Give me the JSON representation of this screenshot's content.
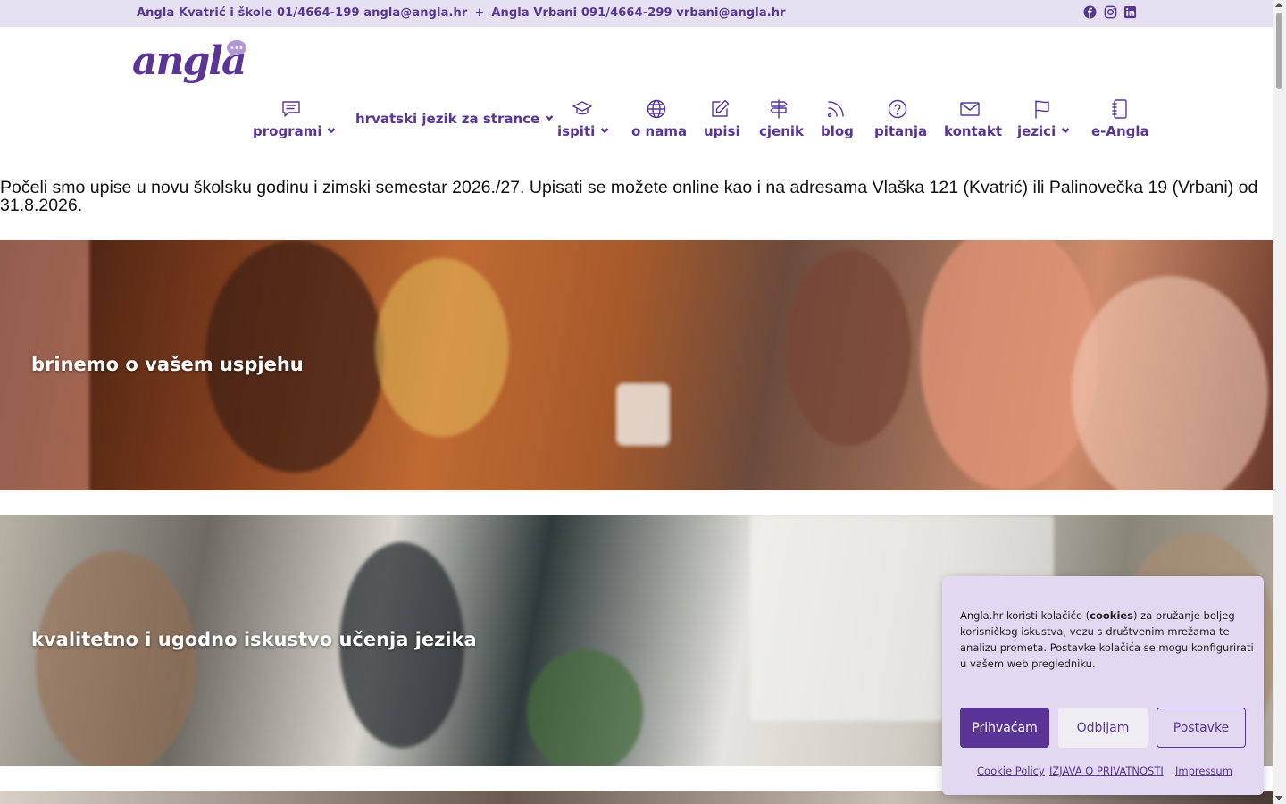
{
  "topbar": {
    "contact_kvatric": "Angla Kvatrić i škole 01/4664-199 angla@angla.hr",
    "separator": "+",
    "contact_vrbani": "Angla Vrbani 091/4664-299 vrbani@angla.hr",
    "social_icons": [
      "facebook-icon",
      "instagram-icon",
      "linkedin-icon"
    ]
  },
  "logo": {
    "text": "angla"
  },
  "nav": {
    "items": [
      {
        "label": "programi",
        "icon": "chat-icon",
        "dropdown": true
      },
      {
        "label": "hrvatski jezik za strance",
        "icon": "",
        "dropdown": true
      },
      {
        "label": "ispiti",
        "icon": "graduation-cap-icon",
        "dropdown": true
      },
      {
        "label": "o nama",
        "icon": "globe-icon",
        "dropdown": false
      },
      {
        "label": "upisi",
        "icon": "edit-icon",
        "dropdown": false
      },
      {
        "label": "cjenik",
        "icon": "signpost-icon",
        "dropdown": false
      },
      {
        "label": "blog",
        "icon": "rss-icon",
        "dropdown": false
      },
      {
        "label": "pitanja",
        "icon": "question-icon",
        "dropdown": false
      },
      {
        "label": "kontakt",
        "icon": "mail-icon",
        "dropdown": false
      },
      {
        "label": "jezici",
        "icon": "flag-icon",
        "dropdown": true
      },
      {
        "label": "e-Angla",
        "icon": "notebook-icon",
        "dropdown": false
      }
    ]
  },
  "announcement": "Počeli smo upise u novu školsku godinu i zimski semestar 2026./27. Upisati se možete online kao i na adresama Vlaška 121 (Kvatrić) ili Palinovečka 19 (Vrbani) od 31.8.2026.",
  "banners": [
    {
      "caption": "brinemo o vašem uspjehu"
    },
    {
      "caption": "kvalitetno i ugodno iskustvo učenja jezika"
    }
  ],
  "cookie": {
    "text_before": "Angla.hr koristi kolačiće (",
    "text_bold": "cookies",
    "text_after": ") za pružanje boljeg korisničkog iskustva, vezu s društvenim mrežama te analizu prometa. Postavke kolačića se mogu konfigurirati u vašem web pregledniku.",
    "accept_label": "Prihvaćam",
    "reject_label": "Odbijam",
    "settings_label": "Postavke",
    "links": [
      "Cookie Policy",
      "IZJAVA O PRIVATNOSTI",
      "Impressum"
    ]
  },
  "colors": {
    "brand": "#5a3596",
    "topbar_bg": "#e6e1f1",
    "cookie_bg": "#e3d8f1"
  }
}
